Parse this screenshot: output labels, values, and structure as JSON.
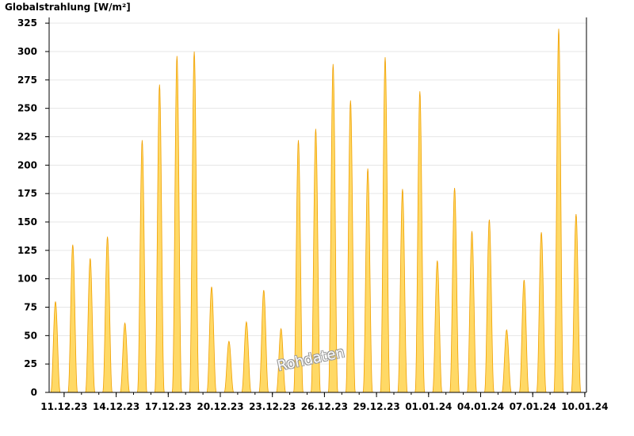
{
  "chart_data": {
    "type": "area",
    "title": "",
    "ylabel": "Globalstrahlung [W/m²]",
    "xlabel": "",
    "ylim": [
      0,
      330
    ],
    "yticks": [
      0,
      25,
      50,
      75,
      100,
      125,
      150,
      175,
      200,
      225,
      250,
      275,
      300,
      325
    ],
    "x_ticks": [
      "11.12.23",
      "14.12.23",
      "17.12.23",
      "20.12.23",
      "23.12.23",
      "26.12.23",
      "29.12.23",
      "01.01.24",
      "04.01.24",
      "07.01.24",
      "10.01.24"
    ],
    "grid": "horizontal",
    "watermark": "Rohdaten",
    "colors": {
      "fill": "#FFD966",
      "line": "#F0A000",
      "grid": "#E6E6E6"
    },
    "series": [
      {
        "x": [
          "10.12.23",
          "11.12.23",
          "12.12.23",
          "13.12.23",
          "14.12.23",
          "15.12.23",
          "16.12.23",
          "17.12.23",
          "18.12.23",
          "19.12.23",
          "20.12.23",
          "21.12.23",
          "22.12.23",
          "23.12.23",
          "24.12.23",
          "25.12.23",
          "26.12.23",
          "27.12.23",
          "28.12.23",
          "29.12.23",
          "30.12.23",
          "31.12.23",
          "01.01.24",
          "02.01.24",
          "03.01.24",
          "04.01.24",
          "05.01.24",
          "06.01.24",
          "07.01.24",
          "08.01.24",
          "09.01.24",
          "10.01.24"
        ],
        "values": [
          80,
          130,
          118,
          137,
          61,
          222,
          271,
          296,
          300,
          93,
          45,
          62,
          90,
          56,
          222,
          232,
          289,
          257,
          197,
          295,
          179,
          265,
          116,
          180,
          142,
          152,
          55,
          99,
          141,
          320,
          157,
          0
        ]
      }
    ]
  }
}
